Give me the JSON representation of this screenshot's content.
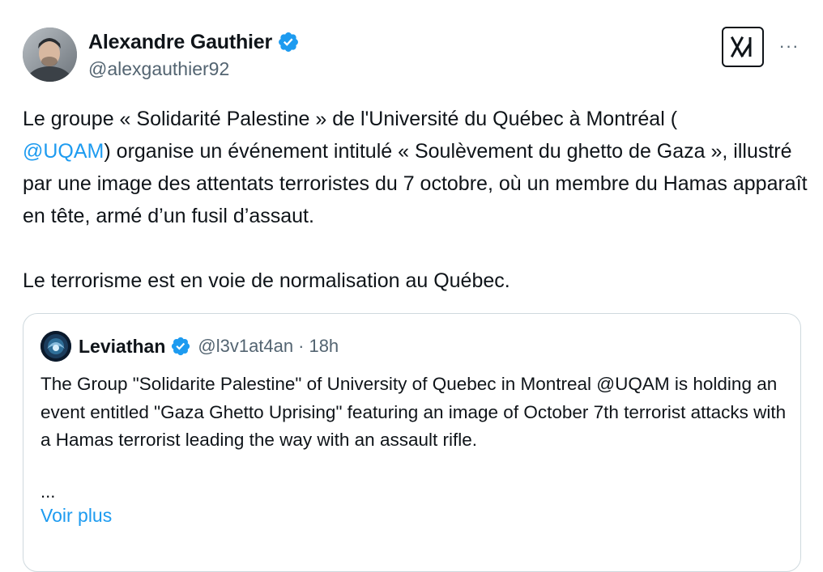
{
  "author": {
    "name": "Alexandre Gauthier",
    "handle": "@alexgauthier92",
    "verified": true
  },
  "tweet": {
    "text_part1": "Le groupe « Solidarité Palestine » de l'Université du Québec à Montréal (",
    "mention": "@UQAM",
    "text_part2": ") organise un événement intitulé « Soulèvement du ghetto de Gaza », illustré par une image des attentats terroristes du 7 octobre, où un membre du Hamas apparaît en tête, armé d’un fusil d’assaut.",
    "text_part3": "Le terrorisme est en voie de normalisation au Québec."
  },
  "header_icons": {
    "grok_icon": "grok-icon",
    "more_icon": "more-icon",
    "more_text": "···"
  },
  "quote": {
    "name": "Leviathan",
    "handle": "@l3v1at4an",
    "separator": "·",
    "time": "18h",
    "verified": true,
    "text": "The Group \"Solidarite Palestine\" of University of Quebec in Montreal @UQAM is holding an event entitled \"Gaza Ghetto Uprising\" featuring an image of October 7th terrorist attacks with a Hamas terrorist leading the way with an assault rifle.",
    "ellipsis": "...",
    "show_more": "Voir plus"
  },
  "colors": {
    "link": "#1d9bf0",
    "text": "#0f1419",
    "secondary": "#536471",
    "border": "#cfd9de"
  }
}
